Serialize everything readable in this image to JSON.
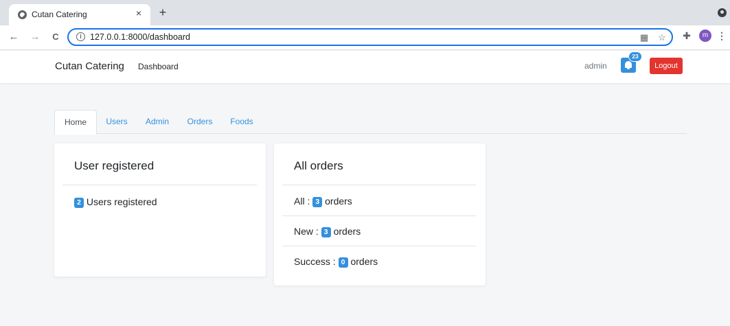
{
  "browser": {
    "tab_title": "Cutan Catering",
    "tab_close": "×",
    "new_tab": "+",
    "back": "←",
    "forward": "→",
    "reload": "C",
    "url": "127.0.0.1:8000/dashboard",
    "info": "i",
    "avatar_letter": "m",
    "menu": "⋮",
    "star": "☆",
    "qr": "▦",
    "puzzle": "✚"
  },
  "navbar": {
    "brand": "Cutan Catering",
    "link": "Dashboard",
    "user": "admin",
    "notification_count": "23",
    "logout": "Logout",
    "accent_color": "#3490dc",
    "danger_color": "#e3342f"
  },
  "tabs": [
    {
      "label": "Home",
      "active": true
    },
    {
      "label": "Users",
      "active": false
    },
    {
      "label": "Admin",
      "active": false
    },
    {
      "label": "Orders",
      "active": false
    },
    {
      "label": "Foods",
      "active": false
    }
  ],
  "users_card": {
    "title": "User registered",
    "count": "2",
    "text": "Users registered"
  },
  "orders_card": {
    "title": "All orders",
    "rows": [
      {
        "label": "All :",
        "count": "3",
        "suffix": "orders"
      },
      {
        "label": "New :",
        "count": "3",
        "suffix": "orders"
      },
      {
        "label": "Success :",
        "count": "0",
        "suffix": "orders"
      }
    ]
  }
}
